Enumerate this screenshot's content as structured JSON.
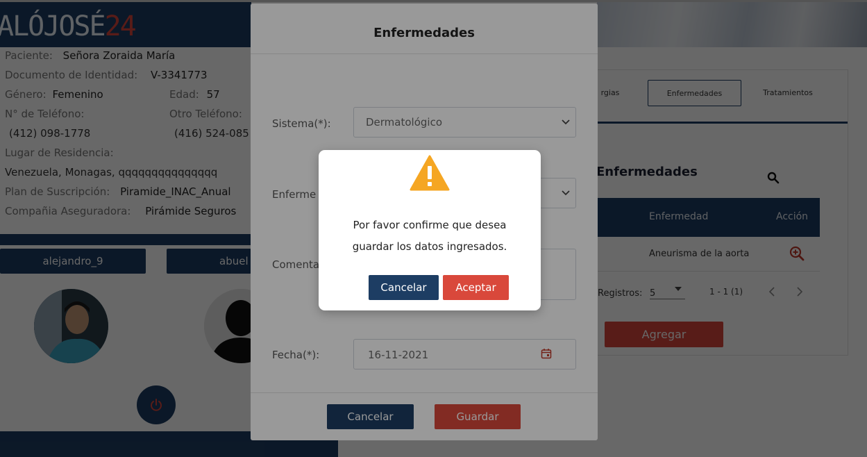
{
  "brand": {
    "logo_main": "ALÓJOSÉ",
    "logo_num": "24"
  },
  "patient": {
    "paciente_label": "Paciente:",
    "paciente_value": "Señora Zoraida María",
    "documento_label": "Documento de Identidad:",
    "documento_value": "V-3341773",
    "genero_label": "Género:",
    "genero_value": "Femenino",
    "edad_label": "Edad:",
    "edad_value": "57",
    "telefono_label": "N° de Teléfono:",
    "telefono_value": "(412) 098-1778",
    "otro_telefono_label": "Otro Teléfono:",
    "otro_telefono_value": "(416) 524-085",
    "residencia_label": "Lugar de Residencia:",
    "residencia_value": "Venezuela, Monagas, qqqqqqqqqqqqqqq",
    "plan_label": "Plan de Suscripción:",
    "plan_value": "Piramide_INAC_Anual",
    "aseguradora_label": "Compañia Aseguradora:",
    "aseguradora_value": "Pirámide Seguros"
  },
  "users": {
    "user1": "alejandro_9",
    "user2": "abuel"
  },
  "right_panel": {
    "tabs": [
      "rgias",
      "Enfermedades",
      "Tratamientos"
    ],
    "active_tab": "Enfermedades",
    "title": "Enfermedades",
    "table_headers": [
      "Enfermedad",
      "Acción"
    ],
    "rows": [
      {
        "enfermedad": "Aneurisma de la aorta"
      }
    ],
    "pager": {
      "label": "Registros:",
      "page_size": "5",
      "range": "1 - 1 (1)"
    },
    "add_button": "Agregar"
  },
  "modal": {
    "title": "Enfermedades",
    "sistema_label": "Sistema(*):",
    "sistema_value": "Dermatológico",
    "enfermedad_label": "Enferme",
    "comentario_label": "Comenta",
    "fecha_label": "Fecha(*):",
    "fecha_value": "16-11-2021",
    "cancel_button": "Cancelar",
    "save_button": "Guardar"
  },
  "confirm": {
    "line1": "Por favor confirme que desea",
    "line2": "guardar los datos ingresados.",
    "cancel_button": "Cancelar",
    "accept_button": "Aceptar"
  },
  "colors": {
    "navy": "#1d3d63",
    "red": "#d9483b",
    "warning": "#f5a623"
  },
  "icons": [
    "warning-icon",
    "search-icon",
    "zoom-in-icon",
    "calendar-icon",
    "power-icon",
    "chevron-down-icon",
    "chevron-left-icon",
    "chevron-right-icon",
    "caret-down-icon"
  ]
}
